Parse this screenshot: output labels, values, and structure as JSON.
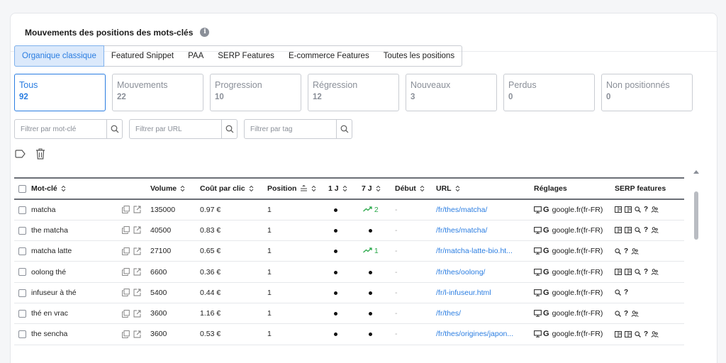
{
  "title": "Mouvements des positions des mots-clés",
  "tabs": [
    {
      "label": "Organique classique",
      "active": true
    },
    {
      "label": "Featured Snippet"
    },
    {
      "label": "PAA"
    },
    {
      "label": "SERP Features"
    },
    {
      "label": "E-commerce Features"
    },
    {
      "label": "Toutes les positions"
    }
  ],
  "stats": [
    {
      "label": "Tous",
      "value": "92",
      "active": true
    },
    {
      "label": "Mouvements",
      "value": "22"
    },
    {
      "label": "Progression",
      "value": "10"
    },
    {
      "label": "Régression",
      "value": "12"
    },
    {
      "label": "Nouveaux",
      "value": "3"
    },
    {
      "label": "Perdus",
      "value": "0"
    },
    {
      "label": "Non positionnés",
      "value": "0"
    }
  ],
  "filters": {
    "keyword_placeholder": "Filtrer par mot-clé",
    "url_placeholder": "Filtrer par URL",
    "tag_placeholder": "Filtrer par tag"
  },
  "table": {
    "headers": {
      "keyword": "Mot-clé",
      "volume": "Volume",
      "cpc": "Coût par clic",
      "position": "Position",
      "d1": "1 J",
      "d7": "7 J",
      "start": "Début",
      "url": "URL",
      "settings": "Réglages",
      "serp": "SERP features"
    },
    "rows": [
      {
        "keyword": "matcha",
        "volume": "135000",
        "cpc": "0.97 €",
        "position": "1",
        "d7": "2",
        "d7_trend": true,
        "start": "-",
        "url": "/fr/thes/matcha/",
        "engine": "google.fr(fr-FR)",
        "serp": [
          "panel",
          "panel",
          "search",
          "question",
          "people"
        ]
      },
      {
        "keyword": "the matcha",
        "volume": "40500",
        "cpc": "0.83 €",
        "position": "1",
        "d7": "",
        "d7_trend": false,
        "start": "-",
        "url": "/fr/thes/matcha/",
        "engine": "google.fr(fr-FR)",
        "serp": [
          "panel",
          "panel",
          "search",
          "question",
          "people"
        ]
      },
      {
        "keyword": "matcha latte",
        "volume": "27100",
        "cpc": "0.65 €",
        "position": "1",
        "d7": "1",
        "d7_trend": true,
        "start": "-",
        "url": "/fr/matcha-latte-bio.ht...",
        "engine": "google.fr(fr-FR)",
        "serp": [
          "search",
          "question",
          "people"
        ]
      },
      {
        "keyword": "oolong thé",
        "volume": "6600",
        "cpc": "0.36 €",
        "position": "1",
        "d7": "",
        "d7_trend": false,
        "start": "-",
        "url": "/fr/thes/oolong/",
        "engine": "google.fr(fr-FR)",
        "serp": [
          "panel",
          "panel",
          "search",
          "question",
          "people"
        ]
      },
      {
        "keyword": "infuseur à thé",
        "volume": "5400",
        "cpc": "0.44 €",
        "position": "1",
        "d7": "",
        "d7_trend": false,
        "start": "-",
        "url": "/fr/l-infuseur.html",
        "engine": "google.fr(fr-FR)",
        "serp": [
          "search",
          "question"
        ]
      },
      {
        "keyword": "thé en vrac",
        "volume": "3600",
        "cpc": "1.16 €",
        "position": "1",
        "d7": "",
        "d7_trend": false,
        "start": "-",
        "url": "/fr/thes/",
        "engine": "google.fr(fr-FR)",
        "serp": [
          "search",
          "question",
          "people"
        ]
      },
      {
        "keyword": "the sencha",
        "volume": "3600",
        "cpc": "0.53 €",
        "position": "1",
        "d7": "",
        "d7_trend": false,
        "start": "-",
        "url": "/fr/thes/origines/japon...",
        "engine": "google.fr(fr-FR)",
        "serp": [
          "panel",
          "panel",
          "search",
          "question",
          "people"
        ]
      }
    ]
  },
  "colors": {
    "accent": "#2a7de1",
    "trend_up": "#2aa84a",
    "active_tab_bg": "#dbe9fb"
  },
  "icons": {
    "info": "info-icon",
    "search": "search-icon",
    "tag": "tag-icon",
    "delete": "trash-icon",
    "sort": "sort-icon",
    "copy": "copy-icon",
    "external": "external-link-icon",
    "device": "desktop-icon",
    "google": "google-icon",
    "trend": "trend-up-icon"
  }
}
